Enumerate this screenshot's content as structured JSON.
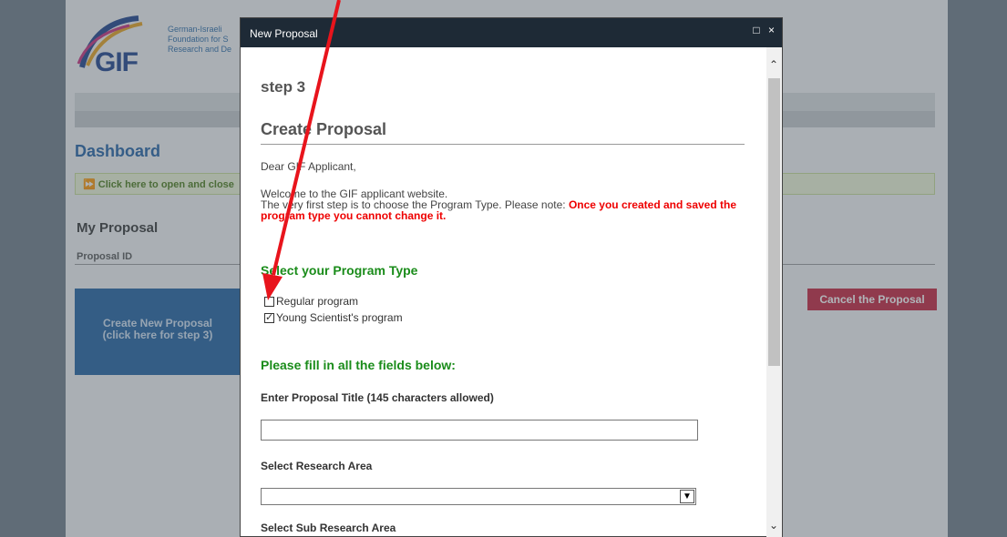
{
  "background": {
    "logo_text": "GIF",
    "logo_subtext": "German-Israeli\nFoundation for S\nResearch and De",
    "dashboard_title": "Dashboard",
    "open_close_bar": "⏩ Click here to open and close",
    "my_proposal_heading": "My Proposal",
    "proposal_id_label": "Proposal ID",
    "create_new_proposal": "Create New Proposal",
    "create_new_proposal_hint": "(click here for step 3)",
    "cancel_button": "Cancel the Proposal"
  },
  "modal": {
    "title": "New Proposal",
    "maximize_icon": "□",
    "close_icon": "×",
    "step_label": "step 3",
    "heading": "Create Proposal",
    "salutation": "Dear GIF Applicant,",
    "welcome_line": "Welcome to the GIF applicant website.",
    "instruction": "The very first step is to choose the Program Type. Please note: ",
    "warning": "Once you created and saved the program type you cannot change it",
    "warning_end": ".",
    "program_type_heading": "Select your Program Type",
    "programs": [
      {
        "label": "Regular program",
        "checked": false
      },
      {
        "label": "Young Scientist's program",
        "checked": true
      }
    ],
    "fill_fields_heading": "Please fill in all the fields below:",
    "title_field_label": "Enter Proposal Title (145 characters allowed)",
    "title_field_value": "",
    "research_area_label": "Select Research Area",
    "research_area_value": "",
    "sub_research_area_label": "Select Sub Research Area"
  },
  "colors": {
    "modal_header": "#1e2a36",
    "green_heading": "#1a8c1a",
    "warning_red": "#e00000",
    "annotation_arrow": "#e8141c"
  }
}
